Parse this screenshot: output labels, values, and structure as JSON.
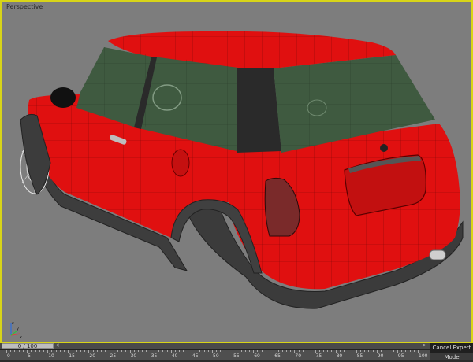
{
  "viewport": {
    "label": "Perspective",
    "border_color": "#d8d418",
    "background_color": "#7d7d7d"
  },
  "model": {
    "body_color": "#e01010",
    "trim_color": "#3a3a3a",
    "glass_color": "#3f5a40"
  },
  "axis_tripod": {
    "x_label": "x",
    "y_label": "y",
    "z_label": "z"
  },
  "timeline": {
    "frame_display": "0 / 100",
    "prev_arrow": "<",
    "next_arrow": ">",
    "ruler_labels": [
      "0",
      "5",
      "10",
      "15",
      "20",
      "25",
      "30",
      "35",
      "40",
      "45",
      "50",
      "55",
      "60",
      "65",
      "70",
      "75",
      "80",
      "85",
      "90",
      "95",
      "100"
    ]
  },
  "status": {
    "cancel_expert_mode": "Cancel Expert Mode"
  }
}
